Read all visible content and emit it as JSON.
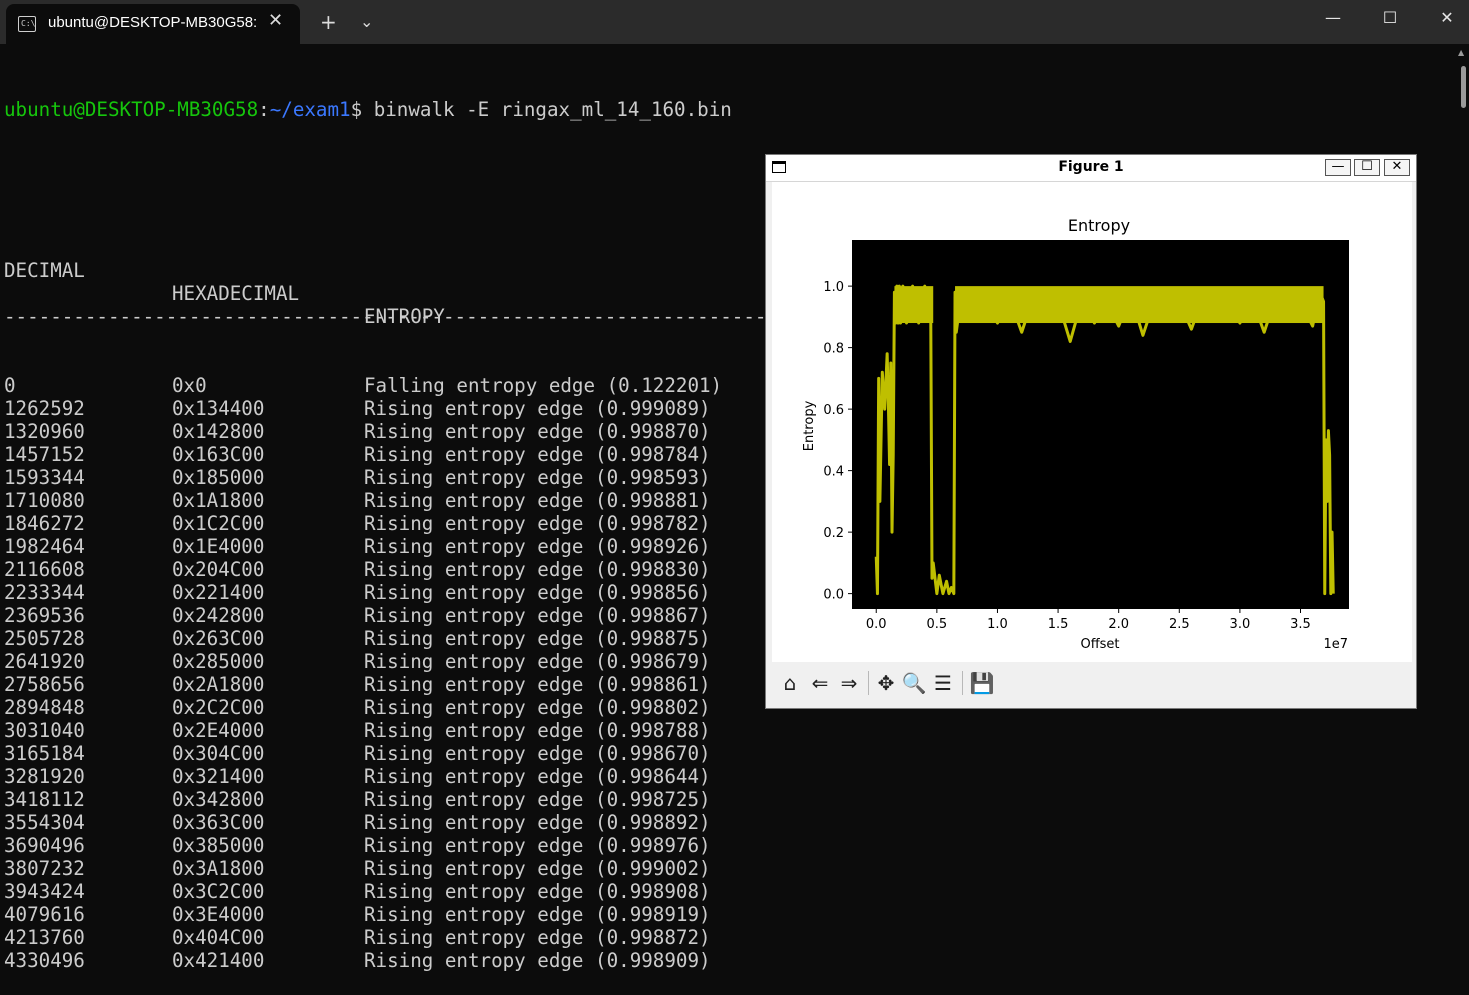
{
  "window": {
    "tab_title": "ubuntu@DESKTOP-MB30G58:",
    "tab_close": "✕",
    "new_tab": "+",
    "tab_dropdown": "⌄",
    "tab_icon_text": "C:\\",
    "minimize": "—",
    "maximize": "☐",
    "close": "✕"
  },
  "terminal": {
    "prompt_user": "ubuntu@DESKTOP-MB30G58",
    "prompt_colon": ":",
    "prompt_path": "~/exam1",
    "prompt_symbol": "$ ",
    "command": "binwalk -E ringax_ml_14_160.bin",
    "headers": [
      "DECIMAL",
      "HEXADECIMAL",
      "ENTROPY"
    ],
    "separator": "--------------------------------------------------------------------------------",
    "rows": [
      [
        "0",
        "0x0",
        "Falling entropy edge (0.122201)"
      ],
      [
        "1262592",
        "0x134400",
        "Rising entropy edge (0.999089)"
      ],
      [
        "1320960",
        "0x142800",
        "Rising entropy edge (0.998870)"
      ],
      [
        "1457152",
        "0x163C00",
        "Rising entropy edge (0.998784)"
      ],
      [
        "1593344",
        "0x185000",
        "Rising entropy edge (0.998593)"
      ],
      [
        "1710080",
        "0x1A1800",
        "Rising entropy edge (0.998881)"
      ],
      [
        "1846272",
        "0x1C2C00",
        "Rising entropy edge (0.998782)"
      ],
      [
        "1982464",
        "0x1E4000",
        "Rising entropy edge (0.998926)"
      ],
      [
        "2116608",
        "0x204C00",
        "Rising entropy edge (0.998830)"
      ],
      [
        "2233344",
        "0x221400",
        "Rising entropy edge (0.998856)"
      ],
      [
        "2369536",
        "0x242800",
        "Rising entropy edge (0.998867)"
      ],
      [
        "2505728",
        "0x263C00",
        "Rising entropy edge (0.998875)"
      ],
      [
        "2641920",
        "0x285000",
        "Rising entropy edge (0.998679)"
      ],
      [
        "2758656",
        "0x2A1800",
        "Rising entropy edge (0.998861)"
      ],
      [
        "2894848",
        "0x2C2C00",
        "Rising entropy edge (0.998802)"
      ],
      [
        "3031040",
        "0x2E4000",
        "Rising entropy edge (0.998788)"
      ],
      [
        "3165184",
        "0x304C00",
        "Rising entropy edge (0.998670)"
      ],
      [
        "3281920",
        "0x321400",
        "Rising entropy edge (0.998644)"
      ],
      [
        "3418112",
        "0x342800",
        "Rising entropy edge (0.998725)"
      ],
      [
        "3554304",
        "0x363C00",
        "Rising entropy edge (0.998892)"
      ],
      [
        "3690496",
        "0x385000",
        "Rising entropy edge (0.998976)"
      ],
      [
        "3807232",
        "0x3A1800",
        "Rising entropy edge (0.999002)"
      ],
      [
        "3943424",
        "0x3C2C00",
        "Rising entropy edge (0.998908)"
      ],
      [
        "4079616",
        "0x3E4000",
        "Rising entropy edge (0.998919)"
      ],
      [
        "4213760",
        "0x404C00",
        "Rising entropy edge (0.998872)"
      ],
      [
        "4330496",
        "0x421400",
        "Rising entropy edge (0.998909)"
      ]
    ]
  },
  "figure": {
    "window_title": "Figure 1",
    "min_btn": "—",
    "max_btn": "☐",
    "close_btn": "✕",
    "toolbar": [
      "home-icon",
      "back-icon",
      "forward-icon",
      "pan-icon",
      "zoom-icon",
      "configure-icon",
      "save-icon"
    ]
  },
  "chart_data": {
    "type": "line",
    "title": "Entropy",
    "xlabel": "Offset",
    "ylabel": "Entropy",
    "x_offset_label": "1e7",
    "xlim": [
      -0.2,
      3.9
    ],
    "ylim": [
      -0.05,
      1.15
    ],
    "xticks": [
      0.0,
      0.5,
      1.0,
      1.5,
      2.0,
      2.5,
      3.0,
      3.5
    ],
    "xtick_labels": [
      "0.0",
      "0.5",
      "1.0",
      "1.5",
      "2.0",
      "2.5",
      "3.0",
      "3.5"
    ],
    "yticks": [
      0.0,
      0.2,
      0.4,
      0.6,
      0.8,
      1.0
    ],
    "ytick_labels": [
      "0.0",
      "0.2",
      "0.4",
      "0.6",
      "0.8",
      "1.0"
    ],
    "background": "#000000",
    "line_color": "#bfbf00",
    "series": [
      {
        "x": [
          0.0,
          0.01,
          0.02,
          0.03,
          0.05,
          0.07,
          0.09,
          0.1,
          0.11,
          0.12,
          0.13,
          0.14,
          0.15,
          0.16,
          0.17,
          0.18,
          0.19,
          0.2,
          0.22,
          0.25,
          0.3,
          0.35,
          0.4,
          0.45,
          0.46,
          0.47,
          0.5,
          0.52,
          0.55,
          0.58,
          0.6,
          0.62,
          0.64,
          0.65,
          0.66,
          0.7,
          0.8,
          0.9,
          1.0,
          1.1,
          1.2,
          1.3,
          1.4,
          1.5,
          1.6,
          1.7,
          1.8,
          1.9,
          2.0,
          2.1,
          2.2,
          2.3,
          2.4,
          2.5,
          2.6,
          2.7,
          2.8,
          2.9,
          3.0,
          3.1,
          3.2,
          3.3,
          3.4,
          3.5,
          3.6,
          3.65,
          3.67,
          3.68,
          3.69,
          3.7,
          3.71,
          3.72,
          3.73,
          3.74,
          3.75,
          3.76,
          3.77
        ],
        "y": [
          0.12,
          0.0,
          0.7,
          0.3,
          0.72,
          0.6,
          0.78,
          0.62,
          0.42,
          0.75,
          0.2,
          0.45,
          0.98,
          0.88,
          1.0,
          0.88,
          1.0,
          0.88,
          1.0,
          0.88,
          1.0,
          0.88,
          1.0,
          0.88,
          0.05,
          0.1,
          0.0,
          0.06,
          0.0,
          0.04,
          0.0,
          0.02,
          0.0,
          0.98,
          0.85,
          0.97,
          0.9,
          0.95,
          0.88,
          0.96,
          0.85,
          0.97,
          0.9,
          0.95,
          0.82,
          0.96,
          0.88,
          0.95,
          0.87,
          0.97,
          0.84,
          0.96,
          0.9,
          0.95,
          0.86,
          0.97,
          0.89,
          0.95,
          0.88,
          0.96,
          0.85,
          0.97,
          0.9,
          0.95,
          0.87,
          0.97,
          0.9,
          0.96,
          0.95,
          0.0,
          0.5,
          0.3,
          0.53,
          0.45,
          0.0,
          0.2,
          0.0
        ]
      }
    ]
  }
}
